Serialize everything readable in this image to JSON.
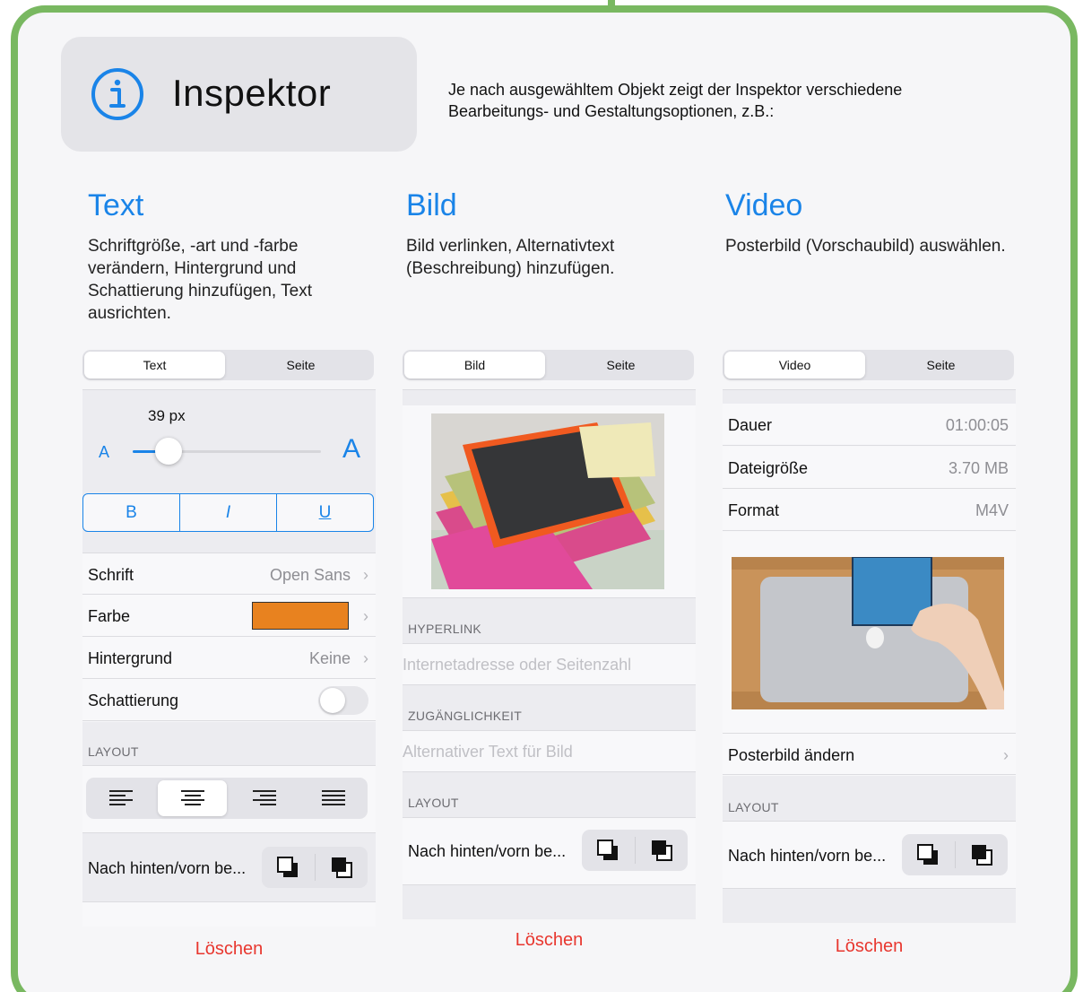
{
  "header": {
    "title": "Inspektor",
    "description": "Je nach ausgewähltem Objekt zeigt der Inspektor verschiedene Bearbeitungs- und Gestaltungsoptionen, z.B.:"
  },
  "columns": [
    {
      "title": "Text",
      "description": "Schriftgröße, -art und -farbe verändern, Hintergrund und Schattierung hinzufügen, Text ausrichten."
    },
    {
      "title": "Bild",
      "description": "Bild verlinken, Alternativtext (Beschreibung) hinzufügen."
    },
    {
      "title": "Video",
      "description": "Posterbild (Vorschaubild) auswählen."
    }
  ],
  "text_panel": {
    "tabs": [
      "Text",
      "Seite"
    ],
    "font_size": "39 px",
    "slider_small": "A",
    "slider_large": "A",
    "slider_level": 0.19,
    "style_buttons": [
      "B",
      "I",
      "U"
    ],
    "rows": [
      {
        "label": "Schrift",
        "value": "Open Sans"
      },
      {
        "label": "Farbe",
        "value": ""
      },
      {
        "label": "Hintergrund",
        "value": "Keine"
      },
      {
        "label": "Schattierung",
        "value": ""
      }
    ],
    "color_swatch": "#e8821f",
    "layout_label": "LAYOUT",
    "layer_label": "Nach hinten/vorn be...",
    "delete": "Löschen"
  },
  "image_panel": {
    "tabs": [
      "Bild",
      "Seite"
    ],
    "hyperlink_label": "HYPERLINK",
    "hyperlink_placeholder": "Internetadresse oder Seitenzahl",
    "access_label": "ZUGÄNGLICHKEIT",
    "access_placeholder": "Alternativer Text für Bild",
    "layout_label": "LAYOUT",
    "layer_label": "Nach hinten/vorn be...",
    "delete": "Löschen"
  },
  "video_panel": {
    "tabs": [
      "Video",
      "Seite"
    ],
    "rows": [
      {
        "label": "Dauer",
        "value": "01:00:05"
      },
      {
        "label": "Dateigröße",
        "value": "3.70 MB"
      },
      {
        "label": "Format",
        "value": "M4V"
      }
    ],
    "poster_label": "Posterbild ändern",
    "layout_label": "LAYOUT",
    "layer_label": "Nach hinten/vorn be...",
    "delete": "Löschen"
  },
  "colors": {
    "accent": "#1a84e8",
    "frame": "#79b861",
    "danger": "#e8372f"
  }
}
